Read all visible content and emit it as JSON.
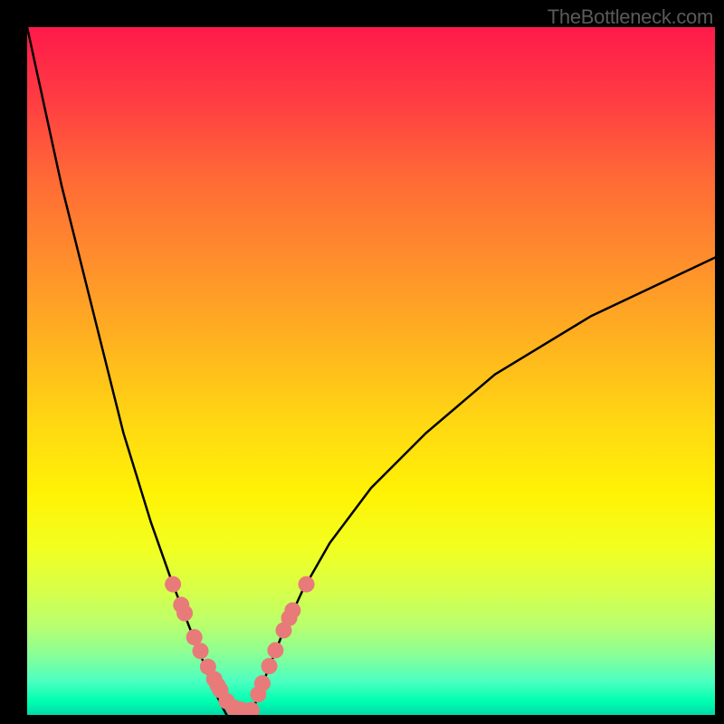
{
  "watermark": "TheBottleneck.com",
  "chart_data": {
    "type": "line",
    "title": "",
    "xlabel": "",
    "ylabel": "",
    "xlim": [
      0,
      100
    ],
    "ylim": [
      0,
      100
    ],
    "grid": false,
    "legend": false,
    "background_gradient": {
      "top": "#ff1a4a",
      "mid": "#fff305",
      "bottom": "#00daa8"
    },
    "series": [
      {
        "name": "left-branch",
        "color": "#000000",
        "x": [
          0,
          5,
          10,
          14,
          18,
          21,
          23.5,
          25.5,
          27,
          28.2,
          29
        ],
        "y": [
          100,
          77,
          57,
          41,
          28,
          19.5,
          13,
          8,
          4,
          1.5,
          0
        ]
      },
      {
        "name": "right-branch",
        "color": "#000000",
        "x": [
          32.5,
          33.5,
          35,
          37,
          40,
          44,
          50,
          58,
          68,
          82,
          100
        ],
        "y": [
          0,
          2.5,
          6.5,
          11.5,
          18,
          25,
          33,
          41,
          49.5,
          58,
          66.5
        ]
      }
    ],
    "markers": [
      {
        "name": "left-dots",
        "color": "#e87a7a",
        "radius": 9,
        "x": [
          21.2,
          22.4,
          22.9,
          24.3,
          25.2,
          26.3,
          27.2,
          27.7,
          28.1,
          29.0,
          30.0,
          31.0,
          31.8
        ],
        "y": [
          19.0,
          16.0,
          14.8,
          11.3,
          9.3,
          7.0,
          5.2,
          4.3,
          3.6,
          2.0,
          1.1,
          0.8,
          0.6
        ]
      },
      {
        "name": "right-dots",
        "color": "#e87a7a",
        "radius": 9,
        "x": [
          32.6,
          33.6,
          34.2,
          35.2,
          36.1,
          37.3,
          38.1,
          38.6,
          40.6
        ],
        "y": [
          0.7,
          3.0,
          4.6,
          7.1,
          9.4,
          12.3,
          14.1,
          15.2,
          19.0
        ]
      }
    ]
  }
}
